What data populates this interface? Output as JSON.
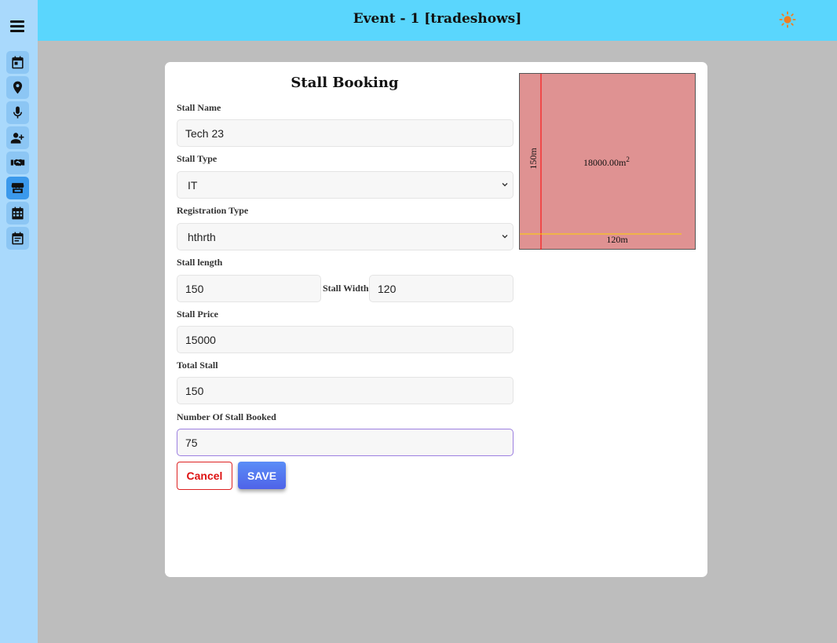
{
  "header": {
    "title": "Event - 1 [tradeshows]",
    "theme_icon": "sun-icon"
  },
  "sidebar": {
    "menu_icon": "hamburger-menu-icon",
    "items": [
      {
        "name": "calendar-event-icon",
        "active": false
      },
      {
        "name": "location-pin-icon",
        "active": false
      },
      {
        "name": "microphone-icon",
        "active": false
      },
      {
        "name": "add-user-icon",
        "active": false
      },
      {
        "name": "handshake-icon",
        "active": false
      },
      {
        "name": "store-icon",
        "active": true
      },
      {
        "name": "calendar-grid-icon",
        "active": false
      },
      {
        "name": "calendar-list-icon",
        "active": false
      }
    ]
  },
  "form": {
    "title": "Stall Booking",
    "stall_name": {
      "label": "Stall Name",
      "value": "Tech 23"
    },
    "stall_type": {
      "label": "Stall Type",
      "value": "IT"
    },
    "registration_type": {
      "label": "Registration Type",
      "value": "hthrth"
    },
    "stall_length": {
      "label": "Stall length",
      "value": "150"
    },
    "stall_width": {
      "label": "Stall Width",
      "value": "120"
    },
    "stall_price": {
      "label": "Stall Price",
      "value": "15000"
    },
    "total_stall": {
      "label": "Total Stall",
      "value": "150"
    },
    "stall_booked": {
      "label": "Number Of Stall Booked",
      "value": "75"
    },
    "cancel_label": "Cancel",
    "save_label": "SAVE"
  },
  "diagram": {
    "area_label": "18000.00m",
    "area_unit_sup": "2",
    "length_label": "150m",
    "width_label": "120m",
    "fill_color": "#df9292",
    "length_line_color": "#ff0000",
    "width_line_color": "#ffd400"
  }
}
